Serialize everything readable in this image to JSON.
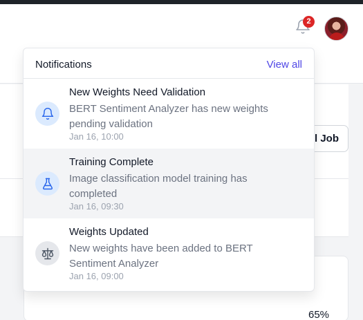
{
  "header": {
    "notification_count": "2"
  },
  "background": {
    "job_button_label": "l Job",
    "progress_label": "65%"
  },
  "notifications": {
    "title": "Notifications",
    "view_all": "View all",
    "items": [
      {
        "title": "New Weights Need Validation",
        "body": "BERT Sentiment Analyzer has new weights pending validation",
        "time": "Jan 16, 10:00",
        "icon": "bell-icon"
      },
      {
        "title": "Training Complete",
        "body": "Image classification model training has completed",
        "time": "Jan 16, 09:30",
        "icon": "flask-icon"
      },
      {
        "title": "Weights Updated",
        "body": "New weights have been added to BERT Sentiment Analyzer",
        "time": "Jan 16, 09:00",
        "icon": "scale-icon"
      }
    ]
  },
  "colors": {
    "accent": "#4f46e5",
    "badge": "#dc2626",
    "icon_blue": "#2563eb"
  }
}
